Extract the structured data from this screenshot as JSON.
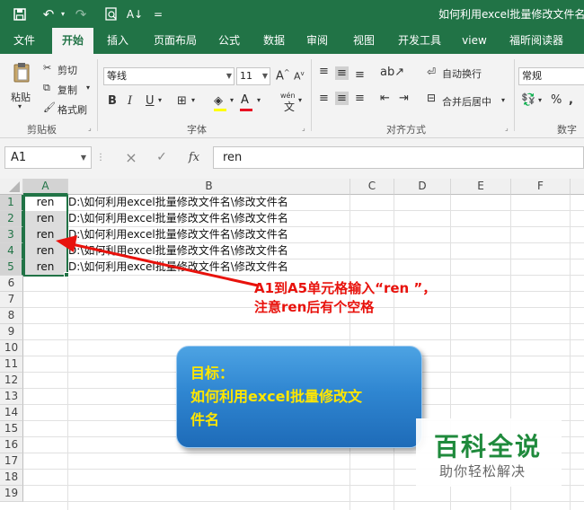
{
  "window": {
    "title": "如何利用excel批量修改文件名.x",
    "qat": {
      "customize": "="
    }
  },
  "tabs": [
    {
      "label": "文件",
      "active": false
    },
    {
      "label": "开始",
      "active": true
    },
    {
      "label": "插入",
      "active": false
    },
    {
      "label": "页面布局",
      "active": false
    },
    {
      "label": "公式",
      "active": false
    },
    {
      "label": "数据",
      "active": false
    },
    {
      "label": "审阅",
      "active": false
    },
    {
      "label": "视图",
      "active": false
    },
    {
      "label": "开发工具",
      "active": false
    },
    {
      "label": "view",
      "active": false
    },
    {
      "label": "福昕阅读器",
      "active": false
    }
  ],
  "ribbon": {
    "clipboard": {
      "paste": "粘贴",
      "cut": "剪切",
      "copy": "复制",
      "format_painter": "格式刷",
      "group": "剪贴板"
    },
    "font": {
      "name": "等线",
      "size": "11",
      "grow": "A",
      "shrink": "A",
      "bold": "B",
      "italic": "I",
      "underline": "U",
      "font_color": "A",
      "phonetic": "wén",
      "group": "字体"
    },
    "alignment": {
      "wrap": "自动换行",
      "merge": "合并后居中",
      "group": "对齐方式"
    },
    "number": {
      "format": "常规",
      "percent": "%",
      "comma": ",",
      "group": "数字"
    }
  },
  "formula_bar": {
    "name_box": "A1",
    "cancel": "×",
    "enter": "✓",
    "fx": "fx",
    "value": "ren"
  },
  "sheet": {
    "columns": [
      "A",
      "B",
      "C",
      "D",
      "E",
      "F"
    ],
    "selected_column": "A",
    "rows": [
      "1",
      "2",
      "3",
      "4",
      "5",
      "6",
      "7",
      "8",
      "9",
      "10",
      "11",
      "12",
      "13",
      "14",
      "15",
      "16",
      "17",
      "18",
      "19"
    ],
    "selected_rows": [
      "1",
      "2",
      "3",
      "4",
      "5"
    ],
    "col_a": [
      "ren",
      "ren",
      "ren",
      "ren",
      "ren"
    ],
    "col_b": [
      "D:\\如何利用excel批量修改文件名\\修改文件名",
      "D:\\如何利用excel批量修改文件名\\修改文件名",
      "D:\\如何利用excel批量修改文件名\\修改文件名",
      "D:\\如何利用excel批量修改文件名\\修改文件名",
      "D:\\如何利用excel批量修改文件名\\修改文件名"
    ]
  },
  "annotations": {
    "note_line1": "A1到A5单元格输入“ren ”，",
    "note_line2": "注意ren后有个空格",
    "goal_line1": "目标：",
    "goal_line2": "如何利用excel批量修改文",
    "goal_line3": "件名",
    "arrow_color": "#e8120c"
  },
  "watermark": {
    "title": "百科全说",
    "subtitle": "助你轻松解决"
  },
  "colors": {
    "accent": "#217346",
    "goal_text": "#ffe600",
    "note": "#e8120c",
    "watermark": "#1f8a3c"
  }
}
